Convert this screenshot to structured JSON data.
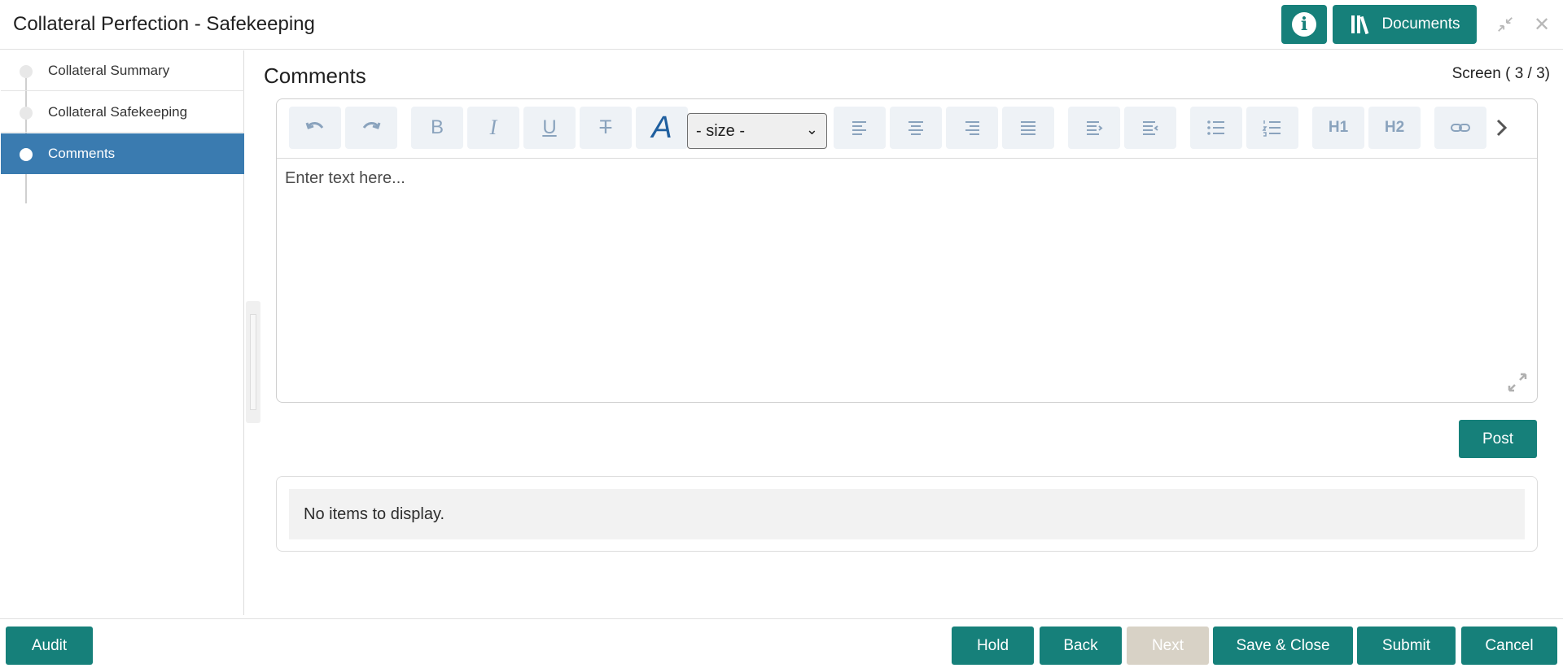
{
  "header": {
    "title": "Collateral Perfection - Safekeeping",
    "info_icon": "info-icon",
    "documents_label": "Documents",
    "documents_icon": "library-icon",
    "minimize_icon": "minimize-icon",
    "close_icon": "close-icon"
  },
  "sidebar": {
    "items": [
      {
        "label": "Collateral Summary",
        "active": false
      },
      {
        "label": "Collateral Safekeeping",
        "active": false
      },
      {
        "label": "Comments",
        "active": true
      }
    ]
  },
  "main": {
    "title": "Comments",
    "screen_counter": "Screen ( 3 / 3)"
  },
  "editor": {
    "toolbar": {
      "undo": "undo-icon",
      "redo": "redo-icon",
      "bold": "bold-icon",
      "italic": "italic-icon",
      "underline": "underline-icon",
      "strikethrough": "strikethrough-icon",
      "font": "font-icon",
      "size_value": "- size -",
      "align_left": "align-left-icon",
      "align_center": "align-center-icon",
      "align_right": "align-right-icon",
      "align_justify": "align-justify-icon",
      "indent": "indent-icon",
      "outdent": "outdent-icon",
      "bullet_list": "bullet-list-icon",
      "numbered_list": "numbered-list-icon",
      "h1": "H1",
      "h2": "H2",
      "link": "link-icon",
      "more": "chevron-right-icon"
    },
    "placeholder": "Enter text here..."
  },
  "post_label": "Post",
  "comments_list": {
    "empty_text": "No items to display."
  },
  "footer": {
    "audit": "Audit",
    "hold": "Hold",
    "back": "Back",
    "next": "Next",
    "save_close": "Save & Close",
    "submit": "Submit",
    "cancel": "Cancel"
  },
  "colors": {
    "primary": "#16807a",
    "sidebar_active": "#3a7bb0",
    "disabled": "#d8d2c6"
  }
}
